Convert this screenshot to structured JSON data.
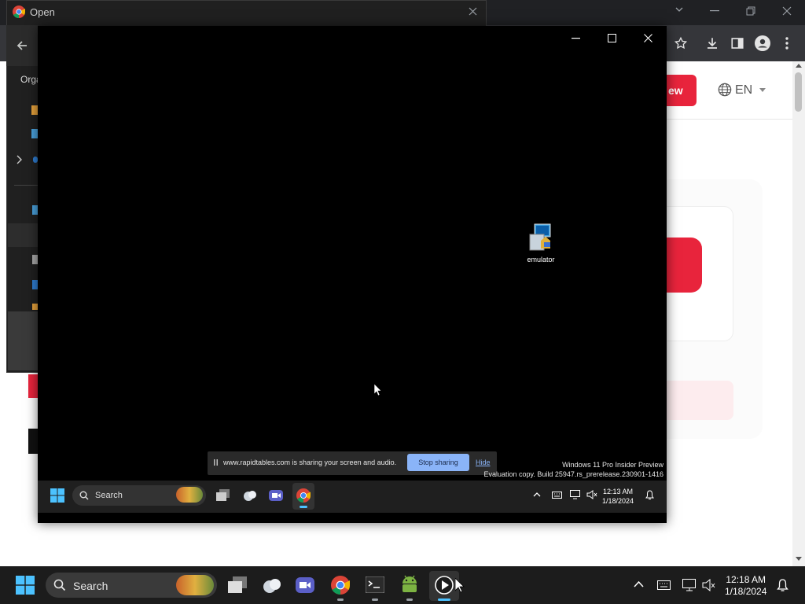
{
  "open_dialog": {
    "title": "Open",
    "nav_text": "Orga"
  },
  "browser": {
    "language": "EN",
    "cta_fragment": "ew"
  },
  "emulator": {
    "desktop_icon_label": "emulator",
    "watermark": {
      "line1": "Windows 11 Pro Insider Preview",
      "line2": "Evaluation copy. Build 25947.rs_prerelease.230901-1416"
    },
    "share_bar": {
      "message": "www.rapidtables.com is sharing your screen and audio.",
      "stop_label": "Stop sharing",
      "hide_label": "Hide"
    },
    "taskbar": {
      "search_label": "Search",
      "time": "12:13 AM",
      "date": "1/18/2024"
    }
  },
  "taskbar": {
    "search_label": "Search",
    "time": "12:18 AM",
    "date": "1/18/2024"
  },
  "colors": {
    "accent_red": "#e8243c",
    "share_blue": "#8ab4f8"
  }
}
